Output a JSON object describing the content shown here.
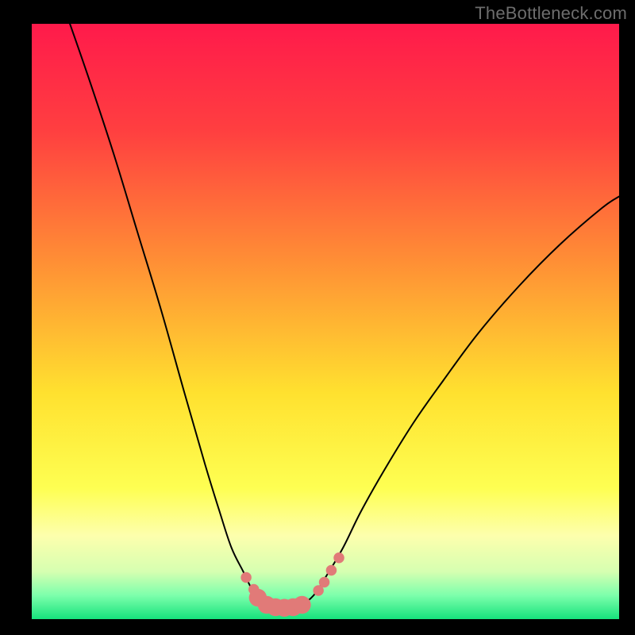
{
  "watermark": "TheBottleneck.com",
  "chart_data": {
    "type": "line",
    "title": "",
    "xlabel": "",
    "ylabel": "",
    "xlim": [
      0,
      100
    ],
    "ylim": [
      0,
      100
    ],
    "grid": false,
    "legend": false,
    "background_gradient": {
      "stops": [
        {
          "offset": 0.0,
          "color": "#ff1a4b"
        },
        {
          "offset": 0.18,
          "color": "#ff3f40"
        },
        {
          "offset": 0.4,
          "color": "#ff8f35"
        },
        {
          "offset": 0.62,
          "color": "#ffe12f"
        },
        {
          "offset": 0.78,
          "color": "#feff52"
        },
        {
          "offset": 0.86,
          "color": "#fdffad"
        },
        {
          "offset": 0.92,
          "color": "#d6ffb1"
        },
        {
          "offset": 0.96,
          "color": "#7dffac"
        },
        {
          "offset": 1.0,
          "color": "#16e27c"
        }
      ]
    },
    "series": [
      {
        "name": "bottleneck-curve",
        "color": "#000000",
        "stroke_width": 2,
        "x": [
          6.5,
          10,
          14,
          18,
          22,
          26,
          29.5,
          32,
          34,
          36,
          37.5,
          39,
          40.5,
          42,
          44,
          46,
          48,
          50,
          53,
          56,
          60,
          65,
          70,
          76,
          83,
          90,
          97,
          100
        ],
        "values": [
          100,
          90,
          78,
          65,
          52,
          38,
          26,
          18,
          12,
          8,
          5,
          3,
          2,
          1.8,
          2,
          2.5,
          4,
          7,
          12,
          18,
          25,
          33,
          40,
          48,
          56,
          63,
          69,
          71
        ]
      }
    ],
    "markers": {
      "name": "recommendation-dots",
      "color": "#e17a78",
      "radius_small_vh": 0.9,
      "radius_large_vh": 1.5,
      "points": [
        {
          "x": 36.5,
          "y": 7.0,
          "size": "small"
        },
        {
          "x": 37.8,
          "y": 5.0,
          "size": "small"
        },
        {
          "x": 38.5,
          "y": 3.6,
          "size": "large"
        },
        {
          "x": 40.0,
          "y": 2.4,
          "size": "large"
        },
        {
          "x": 41.5,
          "y": 2.0,
          "size": "large"
        },
        {
          "x": 43.0,
          "y": 1.9,
          "size": "large"
        },
        {
          "x": 44.5,
          "y": 2.0,
          "size": "large"
        },
        {
          "x": 46.0,
          "y": 2.4,
          "size": "large"
        },
        {
          "x": 48.8,
          "y": 4.8,
          "size": "small"
        },
        {
          "x": 49.8,
          "y": 6.2,
          "size": "small"
        },
        {
          "x": 51.0,
          "y": 8.2,
          "size": "small"
        },
        {
          "x": 52.3,
          "y": 10.3,
          "size": "small"
        }
      ]
    }
  }
}
